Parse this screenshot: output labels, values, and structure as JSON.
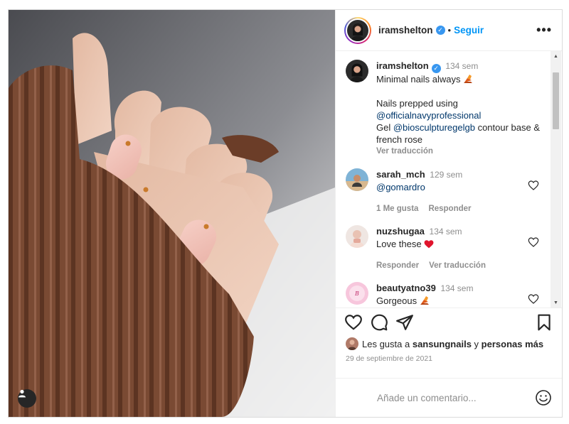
{
  "post": {
    "username": "iramshelton",
    "verified_icon": "verified-badge-icon",
    "separator": "•",
    "follow_label": "Seguir",
    "more_label": "•••"
  },
  "caption": {
    "username": "iramshelton",
    "time": "134 sem",
    "line1": "Minimal nails always",
    "line1_emoji": "nail-polish-emoji",
    "line2": "Nails prepped using",
    "mention1": "@officialnavyprofessional",
    "line3_prefix": "Gel ",
    "mention2": "@biosculpturegelgb",
    "line3_suffix": " contour base & french rose",
    "translate": "Ver traducción"
  },
  "comments": [
    {
      "username": "sarah_mch",
      "time": "129 sem",
      "text": "@gomardro",
      "likes": "1 Me gusta",
      "reply": "Responder"
    },
    {
      "username": "nuzshugaa",
      "time": "134 sem",
      "text": "Love these",
      "emoji": "red-heart-emoji",
      "reply": "Responder",
      "translate": "Ver traducción"
    },
    {
      "username": "beautyatno39",
      "time": "134 sem",
      "text": "Gorgeous",
      "emoji": "nail-polish-emoji"
    }
  ],
  "likes": {
    "prefix": "Les gusta a ",
    "user": "sansungnails",
    "middle": " y ",
    "others": "personas más"
  },
  "date": "29 de septiembre de 2021",
  "add_comment": {
    "placeholder": "Añade un comentario..."
  },
  "colors": {
    "accent": "#0095f6",
    "verified": "#3897f0",
    "heart": "#ed4956",
    "sweater": "#7a4a33",
    "nail": "#f2c1b8",
    "dot": "#c97a2b"
  }
}
